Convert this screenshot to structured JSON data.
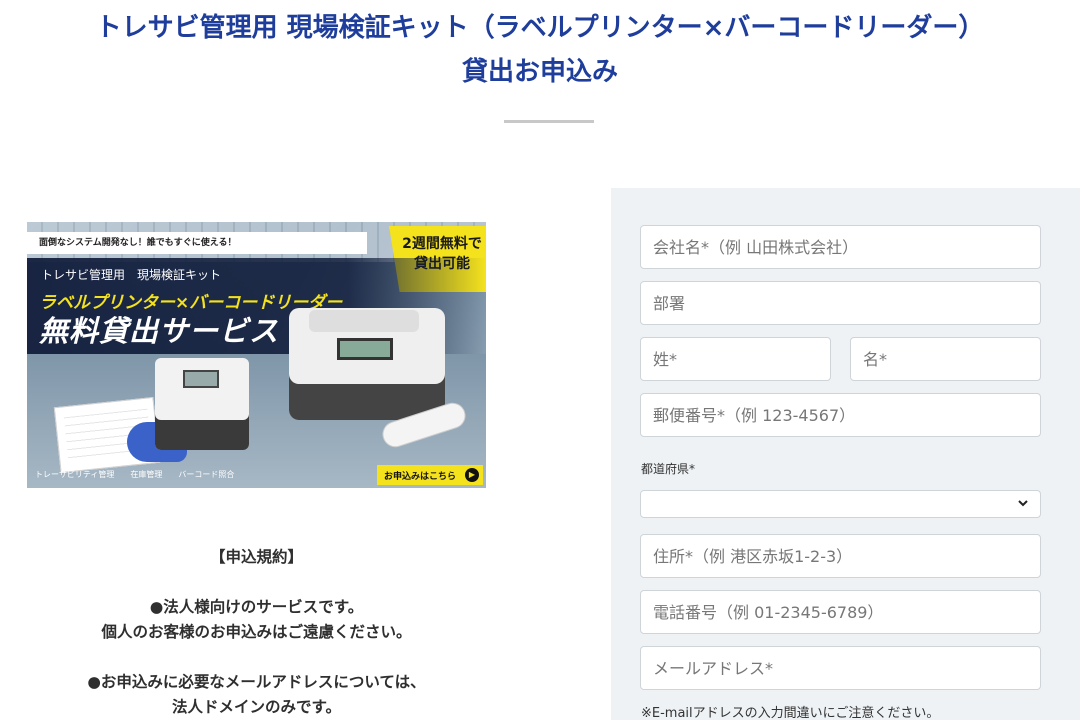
{
  "header": {
    "title_line1": "トレサビ管理用 現場検証キット（ラベルプリンター×バーコードリーダー）",
    "title_line2": "貸出お申込み"
  },
  "banner": {
    "top_strip": "面倒なシステム開発なし！誰でもすぐに使える！",
    "badge_line1": "2週間無料で",
    "badge_line2": "貸出可能",
    "kit_label": "トレサビ管理用　現場検証キット",
    "product_line": "ラベルプリンター×バーコードリーダー",
    "service_line": "無料貸出サービス",
    "tags": "トレーサビリティ管理　　在庫管理　　バーコード照合",
    "cta": "お申込みはこちら",
    "cta_arrow": "▶"
  },
  "terms": {
    "heading": "【申込規約】",
    "p1_line1": "●法人様向けのサービスです。",
    "p1_line2": "個人のお客様のお申込みはご遠慮ください。",
    "p2_line1": "●お申込みに必要なメールアドレスについては、",
    "p2_line2": "法人ドメインのみです。"
  },
  "form": {
    "company_placeholder": "会社名*（例 山田株式会社）",
    "department_placeholder": "部署",
    "last_name_placeholder": "姓*",
    "first_name_placeholder": "名*",
    "postal_placeholder": "郵便番号*（例 123-4567）",
    "prefecture_label": "都道府県*",
    "prefecture_value": "",
    "address_placeholder": "住所*（例 港区赤坂1-2-3）",
    "phone_placeholder": "電話番号（例 01-2345-6789）",
    "email_placeholder": "メールアドレス*",
    "email_note": "※E-mailアドレスの入力間違いにご注意ください。"
  },
  "colors": {
    "title_blue": "#1f3e9b",
    "panel_bg": "#eef2f5",
    "banner_yellow": "#f4e21d"
  }
}
